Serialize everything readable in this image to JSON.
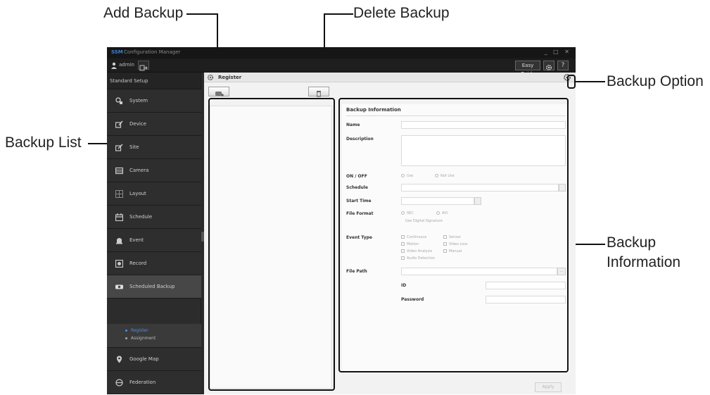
{
  "callouts": {
    "add_backup": "Add Backup",
    "delete_backup": "Delete Backup",
    "backup_option": "Backup Option",
    "backup_list": "Backup List",
    "backup_information_line1": "Backup",
    "backup_information_line2": "Information"
  },
  "window": {
    "brand": "SSM",
    "title": "Configuration Manager",
    "controls": "_ □ ✕"
  },
  "menubar": {
    "user": "admin",
    "easy_guide": "Easy Guide",
    "help": "?"
  },
  "sidebar": {
    "header": "Standard Setup",
    "items": [
      {
        "label": "System",
        "icon": "system-icon"
      },
      {
        "label": "Device",
        "icon": "device-icon"
      },
      {
        "label": "Site",
        "icon": "site-icon"
      },
      {
        "label": "Camera",
        "icon": "camera-icon"
      },
      {
        "label": "Layout",
        "icon": "layout-icon"
      },
      {
        "label": "Schedule",
        "icon": "schedule-icon"
      },
      {
        "label": "Event",
        "icon": "event-icon"
      },
      {
        "label": "Record",
        "icon": "record-icon"
      },
      {
        "label": "Scheduled Backup",
        "icon": "backup-icon"
      },
      {
        "label": "Google Map",
        "icon": "map-icon"
      },
      {
        "label": "Federation",
        "icon": "federation-icon"
      }
    ],
    "sub_items": [
      "Register",
      "Assignment"
    ],
    "active_item": "Scheduled Backup",
    "selected_sub_item": "Register"
  },
  "main": {
    "section_title": "Register",
    "info": {
      "title": "Backup Information",
      "name_label": "Name",
      "description_label": "Description",
      "onoff_label": "ON / OFF",
      "onoff_options": [
        "Use",
        "Not Use"
      ],
      "schedule_label": "Schedule",
      "start_time_label": "Start Time",
      "file_format_label": "File Format",
      "file_format_options": [
        "SEC",
        "AVI"
      ],
      "digital_signature": "Use Digital Signature",
      "event_type_label": "Event Type",
      "event_types": [
        "Continuous",
        "Sensor",
        "Motion",
        "Video Loss",
        "Video Analysis",
        "Manual",
        "Audio Detection"
      ],
      "file_path_label": "File Path",
      "file_path_button": "...",
      "id_label": "ID",
      "password_label": "Password"
    },
    "apply_label": "Apply"
  },
  "colors": {
    "titlebar": "#161616",
    "sidebar": "#2c2c2c",
    "sidebar_active": "#474747",
    "accent": "#4a8fe0",
    "content_bg": "#f2f2f2",
    "callout_line": "#111111"
  }
}
